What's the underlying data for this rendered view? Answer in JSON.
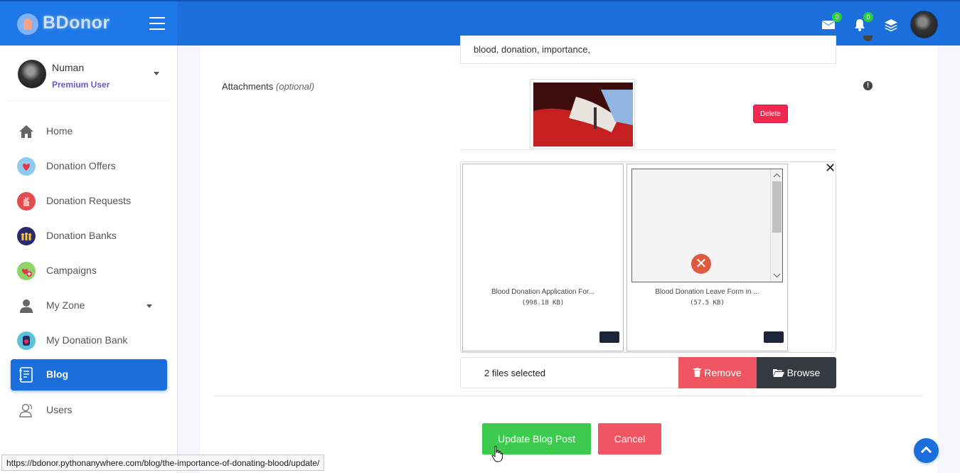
{
  "app": {
    "brand": "BDonor"
  },
  "topbar": {
    "messages_count": "0",
    "notifications_count": "0"
  },
  "user": {
    "name": "Numan",
    "role": "Premium User"
  },
  "sidebar": {
    "items": [
      {
        "label": "Home"
      },
      {
        "label": "Donation Offers"
      },
      {
        "label": "Donation Requests"
      },
      {
        "label": "Donation Banks"
      },
      {
        "label": "Campaigns"
      },
      {
        "label": "My Zone"
      },
      {
        "label": "My Donation Bank"
      },
      {
        "label": "Blog"
      },
      {
        "label": "Users"
      }
    ],
    "active": "Blog"
  },
  "form": {
    "tags_value": "blood, donation, importance,",
    "attachments_label": "Attachments",
    "attachments_optional": "(optional)",
    "delete_label": "Delete",
    "files": [
      {
        "name": "Blood Donation Application For...",
        "size": "(998.18 KB)"
      },
      {
        "name": "Blood Donation Leave Form in ...",
        "size": "(57.5 KB)"
      }
    ],
    "files_selected": "2 files selected",
    "remove_label": "Remove",
    "browse_label": "Browse",
    "update_label": "Update Blog Post",
    "cancel_label": "Cancel"
  },
  "status_bar": {
    "url": "https://bdonor.pythonanywhere.com/blog/the-importance-of-donating-blood/update/"
  },
  "colors": {
    "primary": "#1a6fdc",
    "success": "#3ccb4f",
    "danger": "#ef5662",
    "dark": "#343a40",
    "delete": "#f3284f",
    "badge": "#2ecc40"
  }
}
